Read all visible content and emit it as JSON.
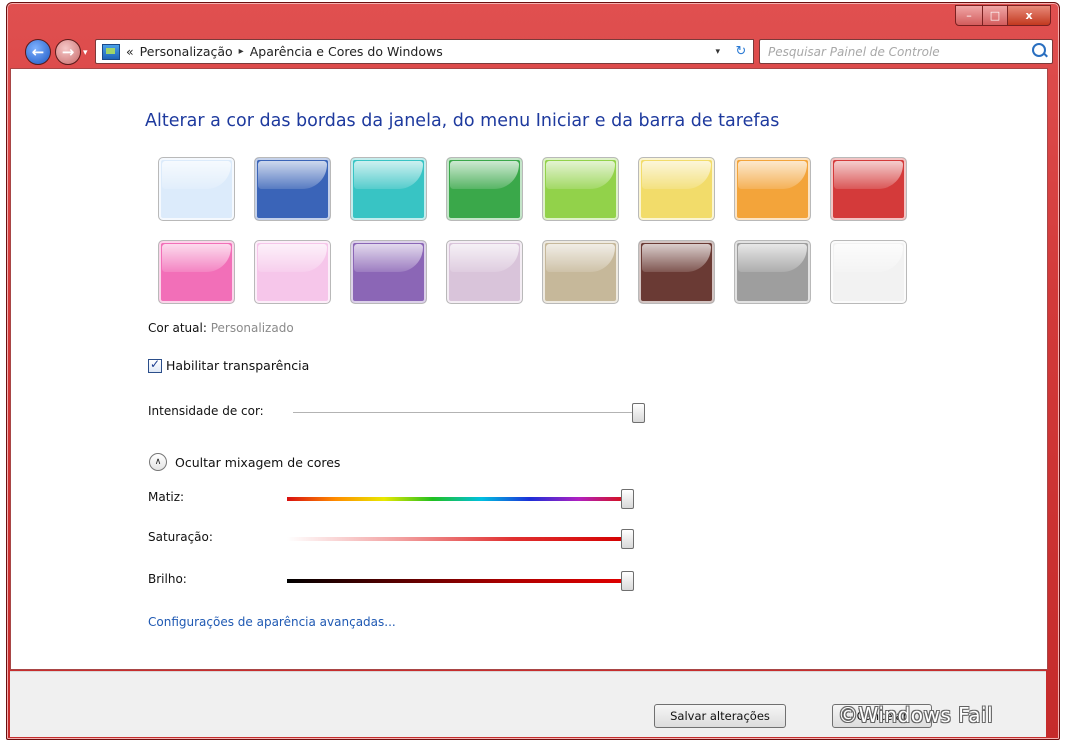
{
  "window": {
    "min_label": "–",
    "max_label": "□",
    "close_label": "x"
  },
  "nav": {
    "back_icon": "back-arrow-icon",
    "forward_icon": "forward-arrow-icon",
    "history_glyph": "▾"
  },
  "address": {
    "prefix": "«",
    "crumbs": [
      "Personalização",
      "Aparência e Cores do Windows"
    ],
    "separator": "▸",
    "dropdown": "▾",
    "refresh": "↻"
  },
  "search": {
    "placeholder": "Pesquisar Painel de Controle"
  },
  "main": {
    "heading": "Alterar a cor das bordas da janela, do menu Iniciar e da barra de tarefas",
    "swatches": [
      {
        "name": "ceu",
        "color": "#dcebfb"
      },
      {
        "name": "crepusculo",
        "color": "#3a64b8"
      },
      {
        "name": "mar",
        "color": "#38c4c4"
      },
      {
        "name": "folha",
        "color": "#3aa84a"
      },
      {
        "name": "lima",
        "color": "#92d24a"
      },
      {
        "name": "gengibre",
        "color": "#f2dc6a"
      },
      {
        "name": "abobora",
        "color": "#f3a43a"
      },
      {
        "name": "tulipa",
        "color": "#d43a3a"
      },
      {
        "name": "rosa",
        "color": "#f26fb8"
      },
      {
        "name": "fucsia-claro",
        "color": "#f6c6ea"
      },
      {
        "name": "violeta",
        "color": "#8b66b6"
      },
      {
        "name": "lavanda",
        "color": "#d9c4da"
      },
      {
        "name": "chocolate-claro",
        "color": "#c6b89a"
      },
      {
        "name": "chocolate",
        "color": "#6a3a34"
      },
      {
        "name": "ardosia",
        "color": "#9e9e9e"
      },
      {
        "name": "geada",
        "color": "#f2f2f2"
      }
    ],
    "current_label": "Cor atual:",
    "current_value": "Personalizado",
    "transparency_label": "Habilitar transparência",
    "transparency_checked": true,
    "intensity_label": "Intensidade de cor:",
    "intensity_value": 1.0,
    "mixer_toggle": "Ocultar mixagem de cores",
    "hue_label": "Matiz:",
    "hue_value": 1.0,
    "saturation_label": "Saturação:",
    "saturation_value": 1.0,
    "brightness_label": "Brilho:",
    "brightness_value": 1.0,
    "advanced_link": "Configurações de aparência avançadas..."
  },
  "footer": {
    "save_label": "Salvar alterações",
    "cancel_label": "Cancelar"
  },
  "watermark": "©Windows Fail"
}
